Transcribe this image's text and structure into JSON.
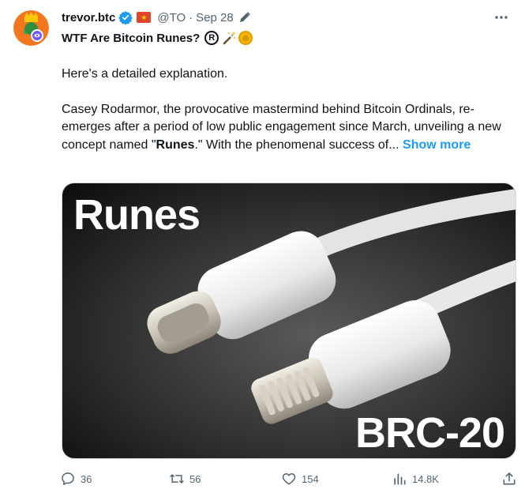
{
  "author": {
    "display_name": "trevor.btc",
    "handle": "@TO",
    "verified_color": "#1d9bf0",
    "flag_emoji_icon": "vietnam-flag-icon"
  },
  "tweet": {
    "separator": "·",
    "time": "Sep 28",
    "title": "WTF Are Bitcoin Runes?",
    "title_emojis": [
      "registered-icon",
      "magic-wand-icon",
      "coin-icon"
    ],
    "intro": "Here's a detailed explanation.",
    "body_before": "Casey Rodarmor, the provocative mastermind behind Bitcoin Ordinals, re-emerges after a period of low public engagement since March, unveiling a new concept named \"",
    "body_bold": "Runes",
    "body_after": ".\" With the phenomenal success of...",
    "show_more": "Show more"
  },
  "media": {
    "overlay_title": "Runes",
    "overlay_tag": "BRC-20"
  },
  "actions": {
    "replies": "36",
    "retweets": "56",
    "likes": "154",
    "views": "14.8K"
  },
  "colors": {
    "accent": "#1d9bf0",
    "secondary_text": "#536471",
    "primary_text": "#0f1419"
  }
}
